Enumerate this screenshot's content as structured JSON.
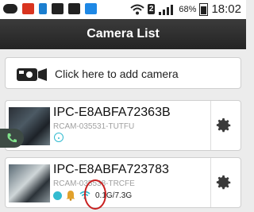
{
  "status_bar": {
    "battery_percent": "68%",
    "time": "18:02",
    "sim_label": "2",
    "icons": [
      "chat-icon",
      "app-icon",
      "phone-icon",
      "image-icon",
      "video-icon",
      "media-icon",
      "wifi-icon",
      "signal-icon",
      "battery-icon"
    ]
  },
  "header": {
    "title": "Camera List"
  },
  "add_camera": {
    "label": "Click here to add camera",
    "icon": "camera-icon"
  },
  "cameras": [
    {
      "name": "IPC-E8ABFA72363B",
      "uid": "RCAM-035531-TUTFU",
      "status": "wifi-offline"
    },
    {
      "name": "IPC-E8ABFA723783",
      "uid": "RCAM-035538-TRCFE",
      "traffic": "0.1G/7.3G",
      "status": "online"
    }
  ],
  "colors": {
    "accent": "#33bbd0",
    "header": "#2e2e2e",
    "annotation": "#c91f1f"
  }
}
